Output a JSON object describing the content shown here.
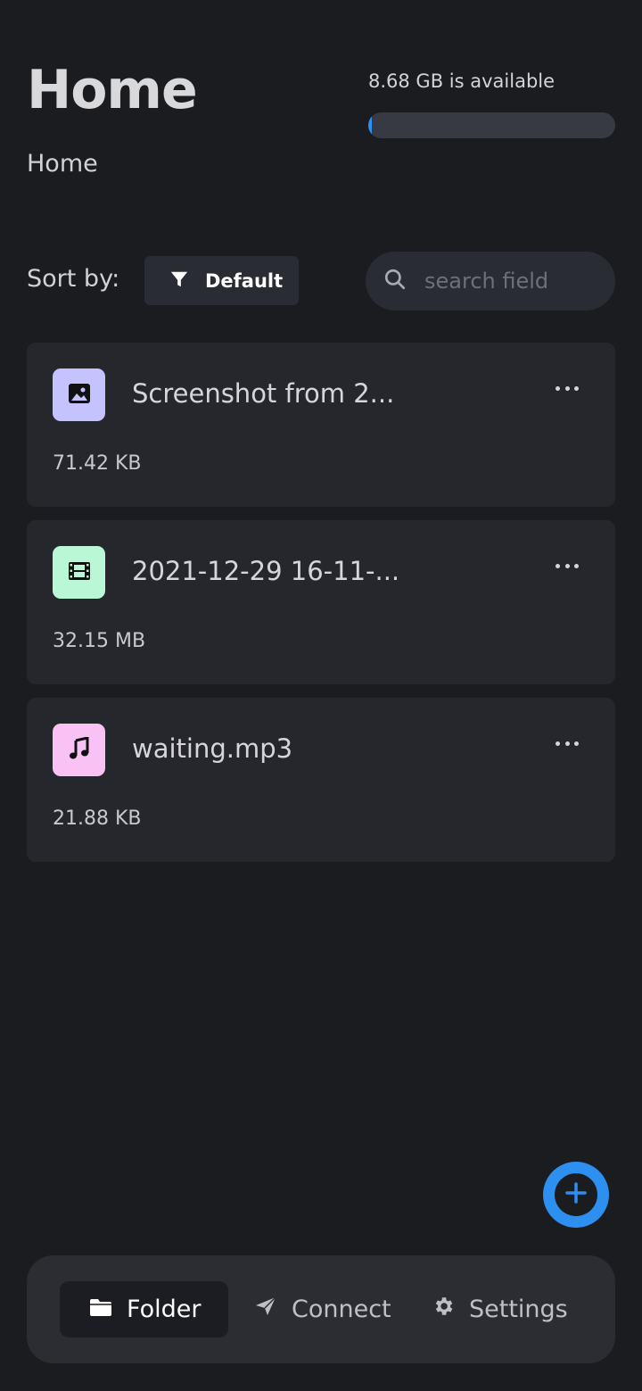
{
  "header": {
    "title": "Home",
    "breadcrumb": "Home"
  },
  "storage": {
    "available_text": "8.68 GB is available",
    "used_fraction": 0.01,
    "accent": "#2d8ff0"
  },
  "toolbar": {
    "sort_label": "Sort by:",
    "sort_value": "Default",
    "sort_icon": "filter-icon",
    "search_placeholder": "search field",
    "search_value": ""
  },
  "files": [
    {
      "name": "Screenshot from 2...",
      "size": "71.42 KB",
      "icon": "image-icon",
      "icon_bg": "#c5c3ff"
    },
    {
      "name": "2021-12-29 16-11-...",
      "size": "32.15 MB",
      "icon": "film-icon",
      "icon_bg": "#b9f7d6"
    },
    {
      "name": "waiting.mp3",
      "size": "21.88 KB",
      "icon": "music-icon",
      "icon_bg": "#f8c2f5"
    }
  ],
  "nav": {
    "items": [
      {
        "label": "Folder",
        "icon": "folder-icon",
        "active": true
      },
      {
        "label": "Connect",
        "icon": "send-icon",
        "active": false
      },
      {
        "label": "Settings",
        "icon": "gear-icon",
        "active": false
      }
    ]
  },
  "fab": {
    "icon": "plus-icon"
  }
}
